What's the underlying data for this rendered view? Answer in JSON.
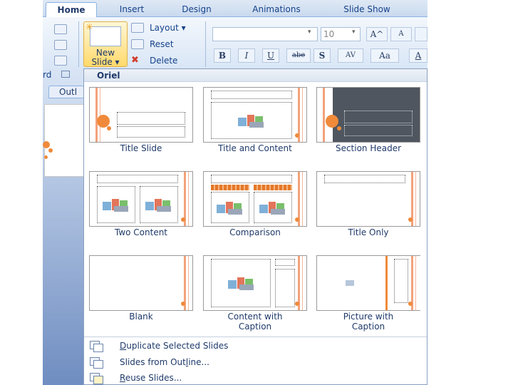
{
  "tabs": [
    {
      "label": "Home",
      "active": true
    },
    {
      "label": "Insert",
      "active": false
    },
    {
      "label": "Design",
      "active": false
    },
    {
      "label": "Animations",
      "active": false
    },
    {
      "label": "Slide Show",
      "active": false
    }
  ],
  "ribbon": {
    "new_slide_line1": "New",
    "new_slide_line2": "Slide ▾",
    "layout_label": "Layout ▾",
    "reset_label": "Reset",
    "delete_label": "Delete",
    "font_size_value": "10",
    "clipboard_group_label": "rd",
    "format_buttons": [
      "B",
      "I",
      "U",
      "abe",
      "S",
      "AV",
      "Aa",
      "A"
    ],
    "grow_font": "A^",
    "shrink_font": "A"
  },
  "left_pane": {
    "outline_tab_label": "Outl"
  },
  "gallery": {
    "theme_name": "Oriel",
    "layouts": [
      {
        "name": "Title Slide"
      },
      {
        "name": "Title and Content"
      },
      {
        "name": "Section Header"
      },
      {
        "name": "Two Content"
      },
      {
        "name": "Comparison"
      },
      {
        "name": "Title Only"
      },
      {
        "name": "Blank"
      },
      {
        "name": "Content with\nCaption",
        "line1": "Content with",
        "line2": "Caption"
      },
      {
        "name": "Picture with\nCaption",
        "line1": "Picture with",
        "line2": "Caption"
      }
    ],
    "menu_items": [
      {
        "accel": "D",
        "rest": "uplicate Selected Slides"
      },
      {
        "pre": "Slides from Out",
        "accel": "l",
        "rest": "ine..."
      },
      {
        "accel": "R",
        "rest": "euse Slides..."
      }
    ]
  },
  "colors": {
    "accent_orange": "#f08a3a",
    "ribbon_blue": "#15428b",
    "section_header_bg": "#4f5660",
    "picture_caption_bg": "#fbe98c"
  }
}
